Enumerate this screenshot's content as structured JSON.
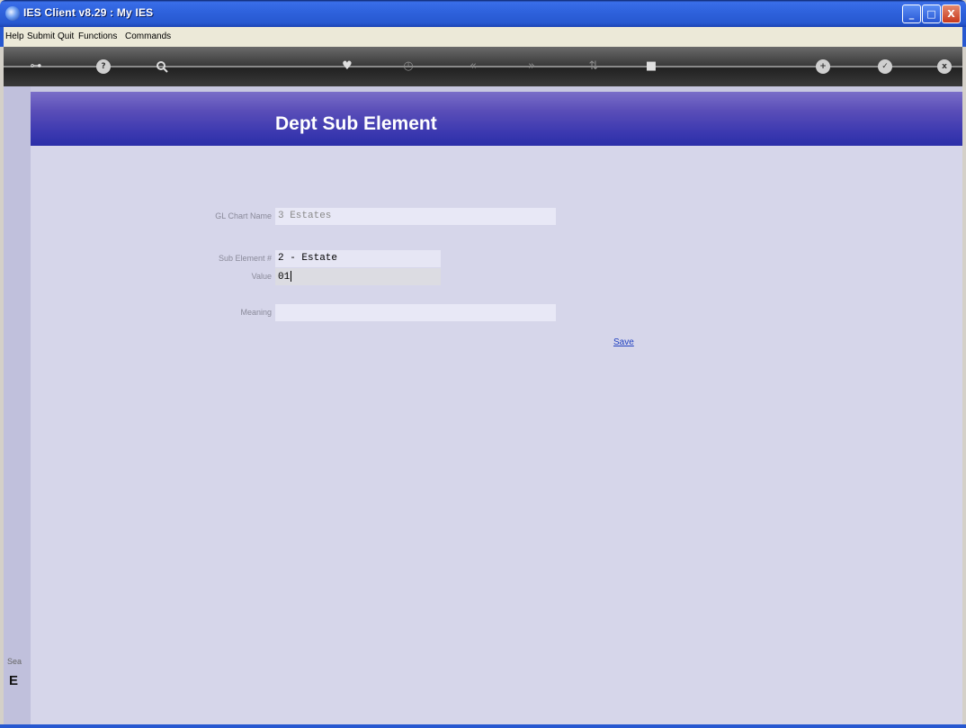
{
  "window": {
    "title": "IES Client v8.29 : My IES",
    "minimize_label": "_",
    "maximize_label": "□",
    "close_label": "X"
  },
  "menu": {
    "items": [
      {
        "label": "Help"
      },
      {
        "label": "Submit"
      },
      {
        "label": "Quit"
      },
      {
        "label": "Functions"
      },
      {
        "label": "Commands"
      }
    ]
  },
  "toolbar": {
    "icons": [
      {
        "name": "key-icon",
        "glyph": "⊶"
      },
      {
        "name": "help-icon",
        "glyph": "?"
      },
      {
        "name": "search-icon",
        "glyph": "🔍"
      },
      {
        "name": "heart-icon",
        "glyph": "♥"
      },
      {
        "name": "clock-icon",
        "glyph": "◷"
      },
      {
        "name": "rewind-icon",
        "glyph": "«"
      },
      {
        "name": "forward-icon",
        "glyph": "»"
      },
      {
        "name": "sort-icon",
        "glyph": "⇅"
      },
      {
        "name": "stop-icon",
        "glyph": "■"
      },
      {
        "name": "add-icon",
        "glyph": "+"
      },
      {
        "name": "check-icon",
        "glyph": "✓"
      },
      {
        "name": "close-icon",
        "glyph": "x"
      }
    ]
  },
  "page": {
    "title": "Dept Sub Element"
  },
  "form": {
    "gl_chart_name": {
      "label": "GL Chart Name",
      "value": "3 Estates"
    },
    "sub_element": {
      "label": "Sub Element #",
      "value": "2 - Estate"
    },
    "value": {
      "label": "Value",
      "value": "01"
    },
    "meaning": {
      "label": "Meaning",
      "value": ""
    },
    "save_label": "Save"
  },
  "side": {
    "text": "Sea",
    "char": "E"
  }
}
